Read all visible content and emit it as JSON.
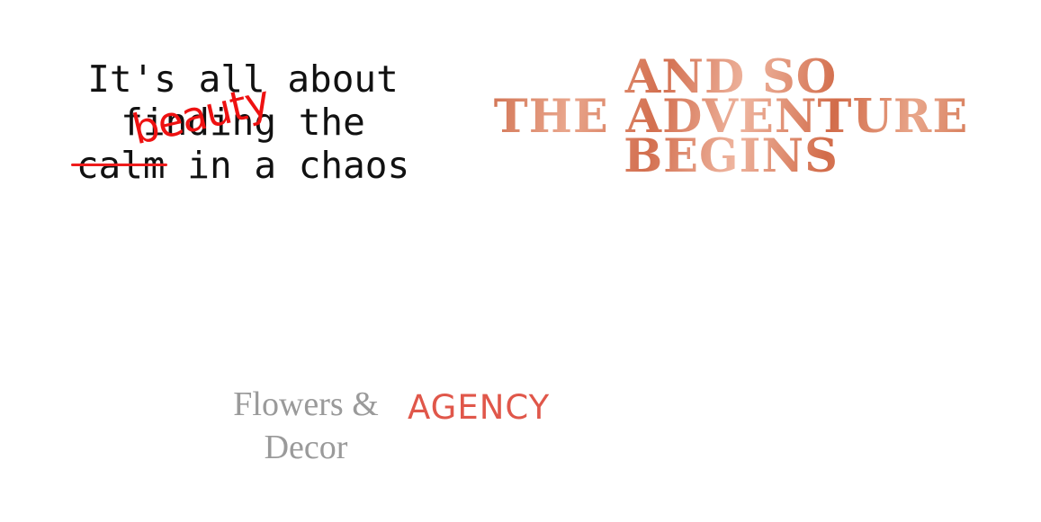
{
  "quote": {
    "line1": "It's all about",
    "line2": "finding the",
    "struck_word": "calm",
    "line3_rest": " in a chaos",
    "handwritten_word": "beauty"
  },
  "headline": {
    "line1": "AND SO",
    "line2": "THE ADVENTURE",
    "line3": "BEGINS"
  },
  "brand": {
    "line1": "Flowers &",
    "line2": "Decor"
  },
  "agency": {
    "label": "AGENCY"
  },
  "colors": {
    "quote_text": "#111111",
    "handwriting_red": "#ee1111",
    "headline_copper": "#d9805e",
    "brand_gray": "#9a9a9a",
    "agency_red": "#e0574a"
  }
}
